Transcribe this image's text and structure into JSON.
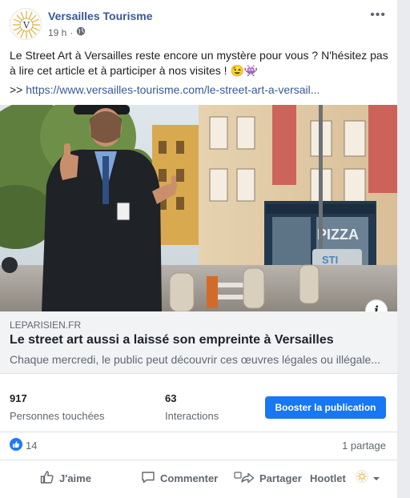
{
  "post": {
    "page_name": "Versailles Tourisme",
    "time": "19 h",
    "separator": "·",
    "privacy_icon": "globe-icon",
    "more_icon": "more-dots-icon",
    "more_glyph": "•••",
    "text": "Le Street Art à Versailles reste encore un mystère pour vous ? N'hésitez pas à lire cet article et à participer à nos visites ! 😉👾",
    "link_prefix": ">> ",
    "link_text": "https://www.versailles-tourisme.com/le-street-art-a-versail..."
  },
  "link_preview": {
    "domain": "LEPARISIEN.FR",
    "title": "Le street art aussi a laissé son empreinte à Versailles",
    "description": "Chaque mercredi, le public peut découvrir ces œuvres légales ou illégale...",
    "info_glyph": "i",
    "image_signs": {
      "shop": "PIZZA",
      "wall": "STI"
    }
  },
  "stats": {
    "reach_value": "917",
    "reach_label": "Personnes touchées",
    "interactions_value": "63",
    "interactions_label": "Interactions",
    "boost_label": "Booster la publication"
  },
  "reactions": {
    "count": "14",
    "shares": "1 partage"
  },
  "actions": {
    "like": "J'aime",
    "comment": "Commenter",
    "share": "Partager",
    "hootlet": "Hootlet"
  },
  "colors": {
    "accent": "#1877f2",
    "page_name": "#385898",
    "secondary_text": "#606770",
    "like_badge": "#2078f4"
  }
}
